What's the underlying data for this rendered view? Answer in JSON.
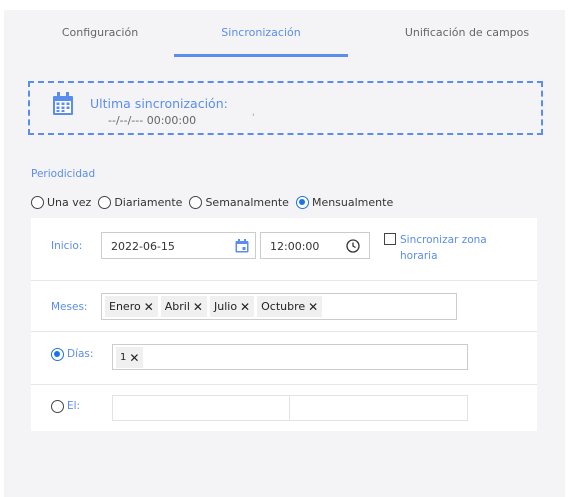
{
  "tabs": [
    {
      "label": "Configuración"
    },
    {
      "label": "Sincronización"
    },
    {
      "label": "Unificación de campos"
    }
  ],
  "active_tab": "Sincronización",
  "sync": {
    "title": "Ultima sincronización:",
    "date": "--/--/--- 00:00:00",
    "tick": "'"
  },
  "periodicidad": {
    "label": "Periodicidad",
    "options": [
      {
        "label": "Una vez",
        "selected": false
      },
      {
        "label": "Diariamente",
        "selected": false
      },
      {
        "label": "Semanalmente",
        "selected": false
      },
      {
        "label": "Mensualmente",
        "selected": true
      }
    ]
  },
  "inicio": {
    "label": "Inicio:",
    "date": "2022-06-15",
    "time": "12:00:00",
    "timezone_label": "Sincronizar zona horaria",
    "timezone_checked": false
  },
  "meses": {
    "label": "Meses:",
    "chips": [
      "Enero",
      "Abril",
      "Julio",
      "Octubre"
    ]
  },
  "dias": {
    "label": "Días:",
    "selected": true,
    "chips": [
      "1"
    ]
  },
  "el": {
    "label": "El:",
    "selected": false,
    "value1": "",
    "value2": ""
  },
  "colors": {
    "accent": "#5b8def",
    "radio_selected": "#1a73e8",
    "panel_bg": "#f4f4f6"
  },
  "icons": {
    "sync_calendar": "calendar-icon",
    "date_picker": "calendar-icon",
    "time_picker": "clock-icon",
    "chip_remove": "close-icon"
  }
}
